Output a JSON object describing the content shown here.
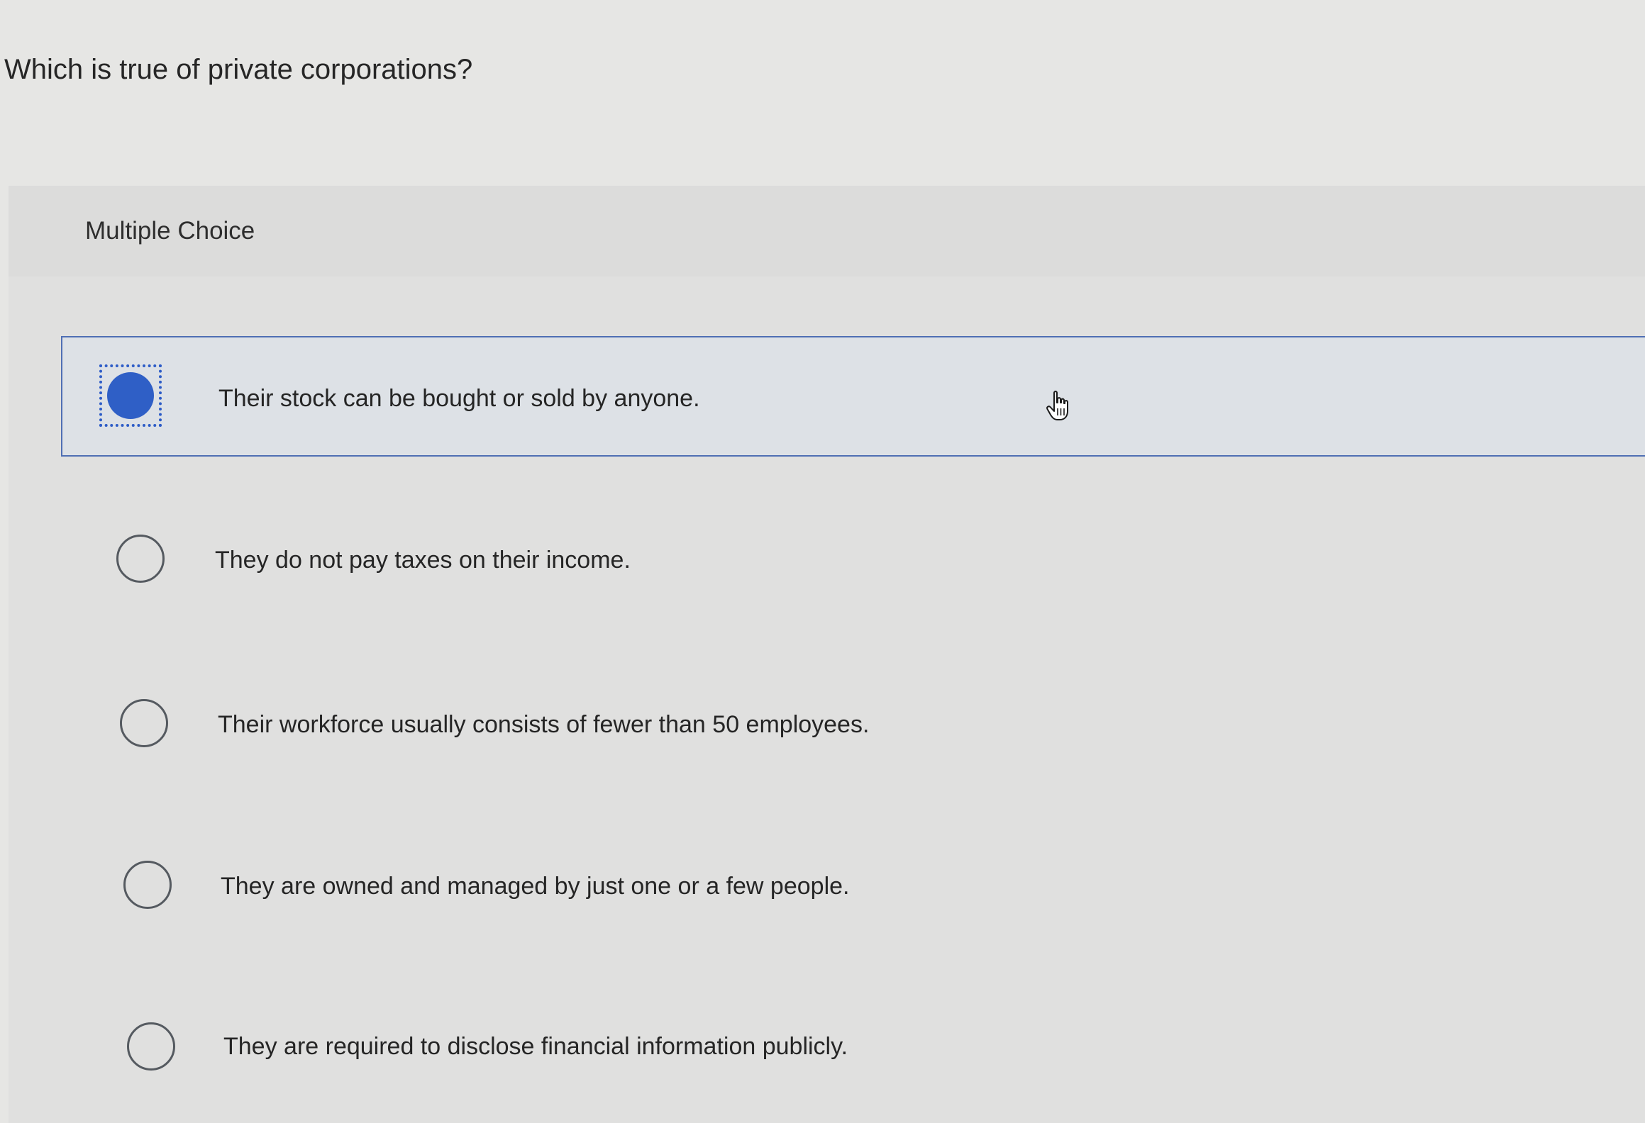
{
  "question": {
    "text": "Which is true of private corporations?"
  },
  "quiz": {
    "type_label": "Multiple Choice",
    "selected_index": 0,
    "options": [
      {
        "label": "Their stock can be bought or sold by anyone.",
        "selected": true
      },
      {
        "label": "They do not pay taxes on their income.",
        "selected": false
      },
      {
        "label": "Their workforce usually consists of fewer than 50 employees.",
        "selected": false
      },
      {
        "label": "They are owned and managed by just one or a few people.",
        "selected": false
      },
      {
        "label": "They are required to disclose financial information publicly.",
        "selected": false
      }
    ]
  },
  "colors": {
    "accent": "#2f5fc6",
    "selected_background": "#dde1e6",
    "selected_border": "#4f6fb4"
  },
  "icons": {
    "cursor": "hand-pointer-icon"
  }
}
